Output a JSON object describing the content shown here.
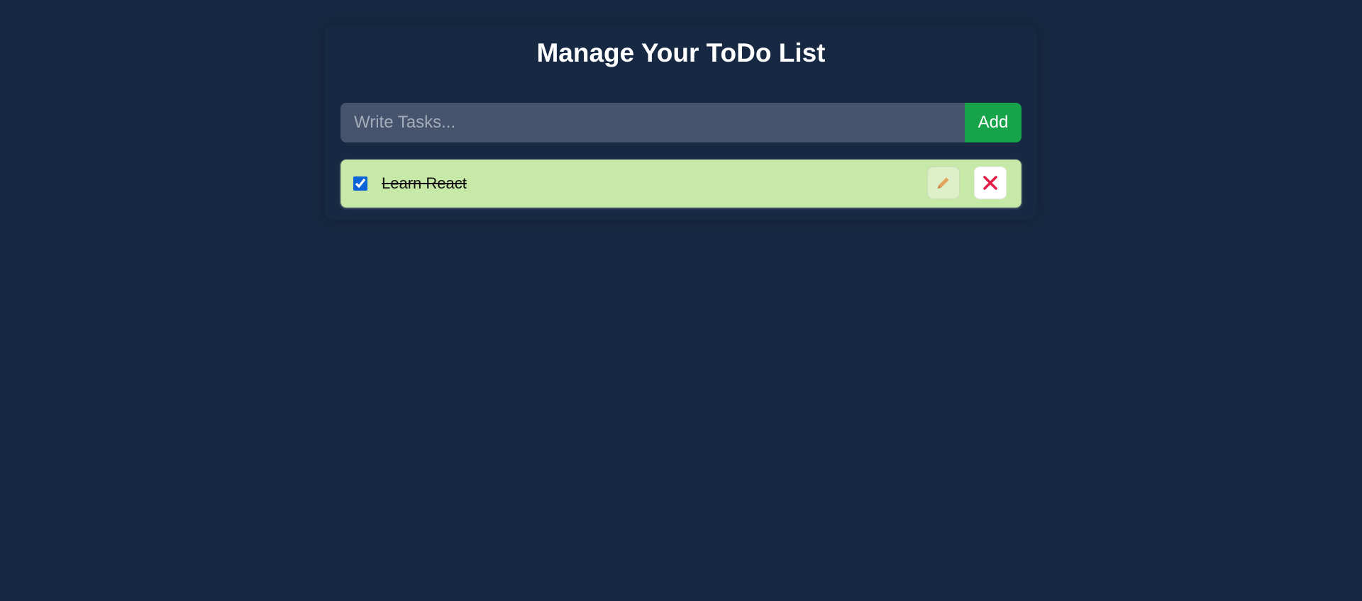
{
  "header": {
    "title": "Manage Your ToDo List"
  },
  "add_form": {
    "input_value": "",
    "placeholder": "Write Tasks...",
    "add_label": "Add"
  },
  "todos": [
    {
      "text": "Learn React",
      "completed": true,
      "edit_icon": "pencil-icon",
      "delete_icon": "close-icon"
    }
  ],
  "colors": {
    "background": "#172842",
    "input_background": "#45546c",
    "add_button": "#16a34a",
    "completed_item": "#c6e9a7",
    "pencil_icon": "#e4a35a",
    "delete_icon": "#e11d48",
    "checkbox": "#0b63d6"
  }
}
